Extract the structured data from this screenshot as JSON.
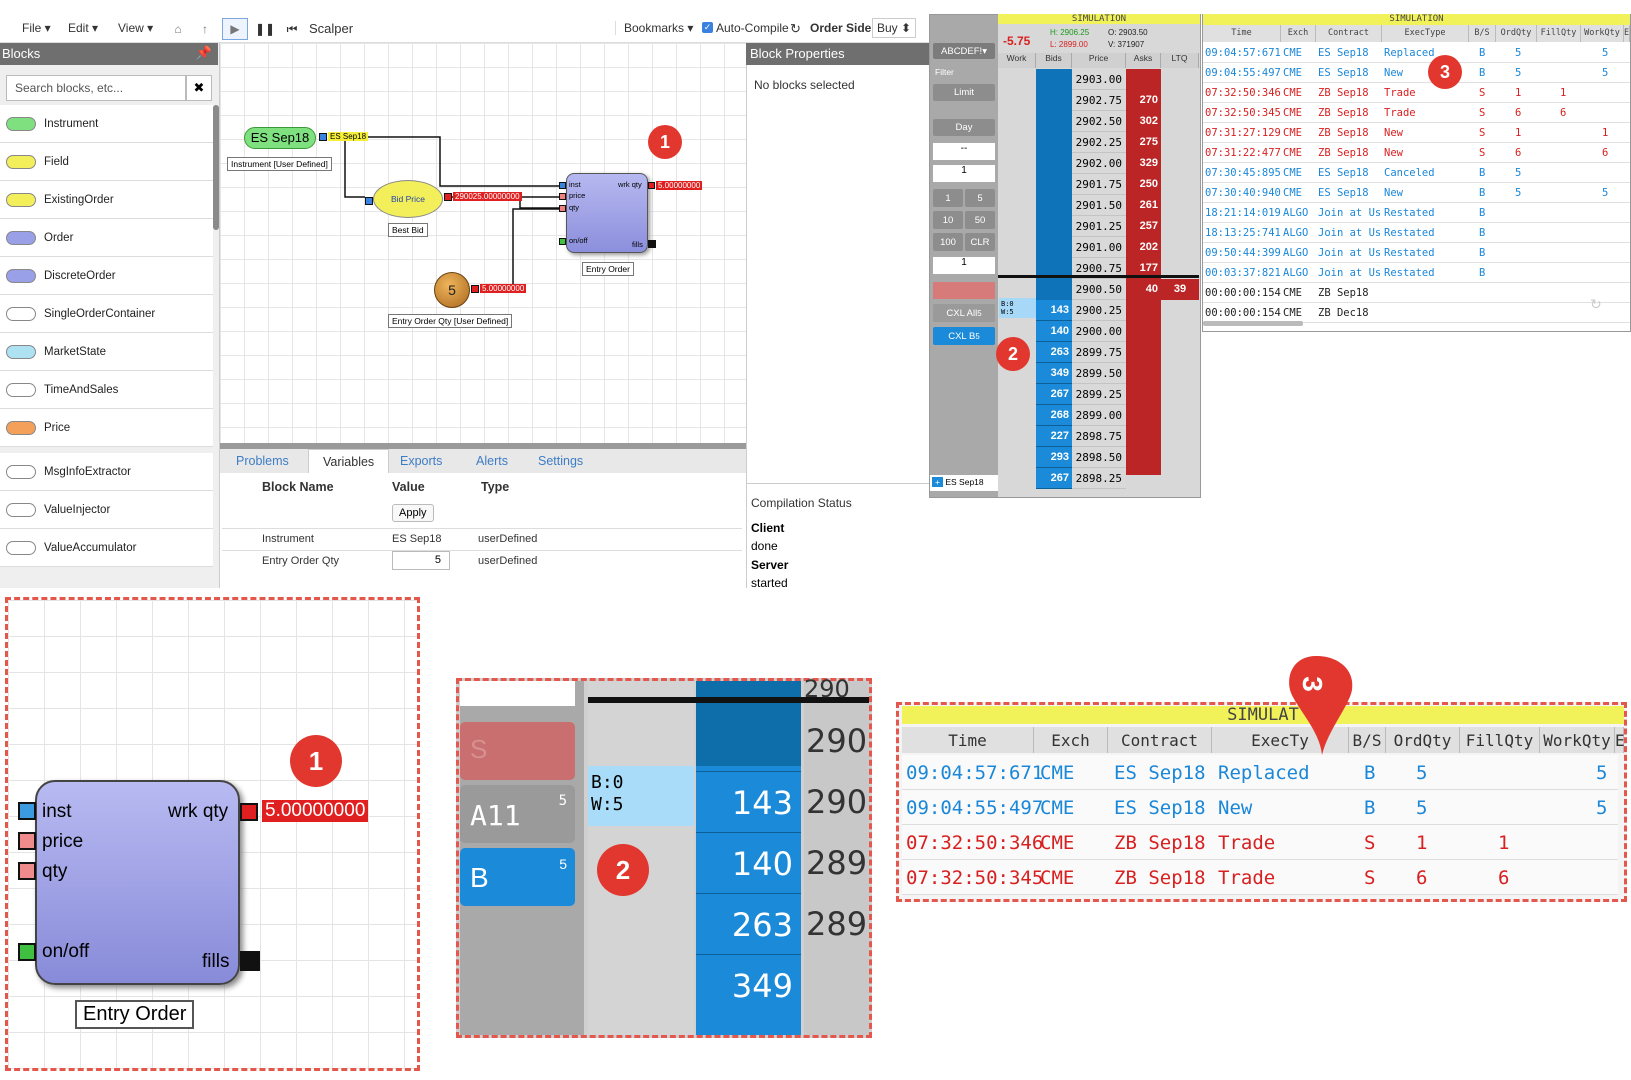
{
  "menu": {
    "file": "File ▾",
    "edit": "Edit ▾",
    "view": "View ▾",
    "app_title": "Scalper",
    "bookmarks": "Bookmarks ▾",
    "auto_compile": "Auto-Compile",
    "order_side_label": "Order Side",
    "order_side_value": "Buy ⬍"
  },
  "sidebar": {
    "header": "Blocks",
    "search_placeholder": "Search blocks, etc...",
    "items": [
      {
        "label": "Instrument",
        "color": "#7ee07e"
      },
      {
        "label": "Field",
        "color": "#f3ef5a"
      },
      {
        "label": "ExistingOrder",
        "color": "#f3ef5a"
      },
      {
        "label": "Order",
        "color": "#9aa0e8"
      },
      {
        "label": "DiscreteOrder",
        "color": "#9aa0e8"
      },
      {
        "label": "SingleOrderContainer",
        "color": "#ffffff"
      },
      {
        "label": "MarketState",
        "color": "#aee2f2"
      },
      {
        "label": "TimeAndSales",
        "color": "#ffffff"
      },
      {
        "label": "Price",
        "color": "#f5a05a"
      },
      {
        "label": "MsgInfoExtractor",
        "color": "#ffffff"
      },
      {
        "label": "ValueInjector",
        "color": "#ffffff"
      },
      {
        "label": "ValueAccumulator",
        "color": "#ffffff"
      }
    ]
  },
  "canvas": {
    "instrument_block": "ES Sep18",
    "instrument_out": "ES Sep18",
    "instrument_label": "Instrument [User Defined]",
    "bid_block": "Bid Price",
    "bid_label": "Best Bid",
    "bid_value": "290025.00000000",
    "qty_block": "5",
    "qty_value": "5.00000000",
    "qty_label": "Entry Order Qty [User Defined]",
    "order_label": "Entry Order",
    "order_ports": {
      "inst": "inst",
      "price": "price",
      "qty": "qty",
      "onoff": "on/off",
      "wrk": "wrk qty",
      "fills": "fills"
    },
    "order_value": "5.00000000",
    "callout": "1"
  },
  "bottom": {
    "tabs": [
      "Problems",
      "Variables",
      "Exports",
      "Alerts",
      "Settings"
    ],
    "headers": {
      "name": "Block Name",
      "value": "Value",
      "type": "Type"
    },
    "apply": "Apply",
    "rows": [
      {
        "name": "Instrument",
        "value": "ES Sep18",
        "type": "userDefined"
      },
      {
        "name": "Entry Order Qty",
        "value": "5",
        "type": "userDefined"
      }
    ]
  },
  "props": {
    "header": "Block Properties",
    "empty": "No blocks selected",
    "status_title": "Compilation Status",
    "client_label": "Client",
    "client_value": "done",
    "server_label": "Server",
    "server_value": "started"
  },
  "dom": {
    "sim": "SIMULATION",
    "change": "-5.75",
    "high": "H: 2906.25",
    "low": "L: 2899.00",
    "open": "O: 2903.50",
    "volume": "V: 371907",
    "account": "ABCDEF!▾",
    "filter": "Filter",
    "order_type": "Limit",
    "tif": "Day",
    "dash": "--",
    "qty": "1",
    "qty2": "1",
    "quick": [
      "1",
      "5",
      "10",
      "50",
      "100",
      "CLR"
    ],
    "cxl_all": "CXL All",
    "cxl_all_n": "5",
    "cxl_b": "CXL B",
    "cxl_b_n": "5",
    "footer_instr": "ES Sep18",
    "cols": [
      "Work",
      "Bids",
      "Price",
      "Asks",
      "LTQ"
    ],
    "work_label": "B:0\nW:5",
    "callout": "2",
    "ladder": [
      {
        "price": "2903.00",
        "bid": "",
        "ask": ""
      },
      {
        "price": "2902.75",
        "bid": "",
        "ask": "270"
      },
      {
        "price": "2902.50",
        "bid": "",
        "ask": "302"
      },
      {
        "price": "2902.25",
        "bid": "",
        "ask": "275"
      },
      {
        "price": "2902.00",
        "bid": "",
        "ask": "329"
      },
      {
        "price": "2901.75",
        "bid": "",
        "ask": "250"
      },
      {
        "price": "2901.50",
        "bid": "",
        "ask": "261"
      },
      {
        "price": "2901.25",
        "bid": "",
        "ask": "257"
      },
      {
        "price": "2901.00",
        "bid": "",
        "ask": "202"
      },
      {
        "price": "2900.75",
        "bid": "",
        "ask": "177"
      },
      {
        "price": "2900.50",
        "bid": "",
        "ask": "40",
        "ltq": "39"
      },
      {
        "price": "2900.25",
        "bid": "143",
        "ask": ""
      },
      {
        "price": "2900.00",
        "bid": "140",
        "ask": ""
      },
      {
        "price": "2899.75",
        "bid": "263",
        "ask": ""
      },
      {
        "price": "2899.50",
        "bid": "349",
        "ask": ""
      },
      {
        "price": "2899.25",
        "bid": "267",
        "ask": ""
      },
      {
        "price": "2899.00",
        "bid": "268",
        "ask": ""
      },
      {
        "price": "2898.75",
        "bid": "227",
        "ask": ""
      },
      {
        "price": "2898.50",
        "bid": "293",
        "ask": ""
      },
      {
        "price": "2898.25",
        "bid": "267",
        "ask": ""
      }
    ]
  },
  "orderbook": {
    "sim": "SIMULATION",
    "cols": [
      "Time",
      "Exch",
      "Contract",
      "ExecType",
      "B/S",
      "OrdQty",
      "FillQty",
      "WorkQty",
      "E"
    ],
    "callout": "3",
    "rows": [
      {
        "time": "09:04:57:671",
        "exch": "CME",
        "contract": "ES Sep18",
        "exec": "Replaced",
        "bs": "B",
        "ord": "5",
        "fill": "",
        "work": "5",
        "color": "#1a87d8"
      },
      {
        "time": "09:04:55:497",
        "exch": "CME",
        "contract": "ES Sep18",
        "exec": "New",
        "bs": "B",
        "ord": "5",
        "fill": "",
        "work": "5",
        "color": "#1a87d8"
      },
      {
        "time": "07:32:50:346",
        "exch": "CME",
        "contract": "ZB Sep18",
        "exec": "Trade",
        "bs": "S",
        "ord": "1",
        "fill": "1",
        "work": "",
        "color": "#d82020"
      },
      {
        "time": "07:32:50:345",
        "exch": "CME",
        "contract": "ZB Sep18",
        "exec": "Trade",
        "bs": "S",
        "ord": "6",
        "fill": "6",
        "work": "",
        "color": "#d82020"
      },
      {
        "time": "07:31:27:129",
        "exch": "CME",
        "contract": "ZB Sep18",
        "exec": "New",
        "bs": "S",
        "ord": "1",
        "fill": "",
        "work": "1",
        "color": "#d82020"
      },
      {
        "time": "07:31:22:477",
        "exch": "CME",
        "contract": "ZB Sep18",
        "exec": "New",
        "bs": "S",
        "ord": "6",
        "fill": "",
        "work": "6",
        "color": "#d82020"
      },
      {
        "time": "07:30:45:895",
        "exch": "CME",
        "contract": "ES Sep18",
        "exec": "Canceled",
        "bs": "B",
        "ord": "5",
        "fill": "",
        "work": "",
        "color": "#1a87d8"
      },
      {
        "time": "07:30:40:940",
        "exch": "CME",
        "contract": "ES Sep18",
        "exec": "New",
        "bs": "B",
        "ord": "5",
        "fill": "",
        "work": "5",
        "color": "#1a87d8"
      },
      {
        "time": "18:21:14:019",
        "exch": "ALGO",
        "contract": "Join at Us",
        "exec": "Restated",
        "bs": "B",
        "ord": "",
        "fill": "",
        "work": "",
        "color": "#1a87d8"
      },
      {
        "time": "18:13:25:741",
        "exch": "ALGO",
        "contract": "Join at Us",
        "exec": "Restated",
        "bs": "B",
        "ord": "",
        "fill": "",
        "work": "",
        "color": "#1a87d8"
      },
      {
        "time": "09:50:44:399",
        "exch": "ALGO",
        "contract": "Join at Us",
        "exec": "Restated",
        "bs": "B",
        "ord": "",
        "fill": "",
        "work": "",
        "color": "#1a87d8"
      },
      {
        "time": "00:03:37:821",
        "exch": "ALGO",
        "contract": "Join at Us",
        "exec": "Restated",
        "bs": "B",
        "ord": "",
        "fill": "",
        "work": "",
        "color": "#1a87d8"
      },
      {
        "time": "00:00:00:154",
        "exch": "CME",
        "contract": "ZB Sep18",
        "exec": "",
        "bs": "",
        "ord": "",
        "fill": "",
        "work": "",
        "color": "#222222"
      },
      {
        "time": "00:00:00:154",
        "exch": "CME",
        "contract": "ZB Dec18",
        "exec": "",
        "bs": "",
        "ord": "",
        "fill": "",
        "work": "",
        "color": "#222222"
      }
    ]
  },
  "zoom1": {
    "ports": {
      "inst": "inst",
      "price": "price",
      "qty": "qty",
      "onoff": "on/off",
      "wrk": "wrk qty",
      "fills": "fills"
    },
    "value": "5.00000000",
    "label": "Entry Order",
    "callout": "1"
  },
  "zoom2": {
    "all": "A11",
    "all_n": "5",
    "b": "B",
    "b_n": "5",
    "s": "S",
    "work": "B:0\nW:5",
    "bids": [
      "143",
      "140",
      "263",
      "349"
    ],
    "prices": [
      "290",
      "290",
      "289",
      "289"
    ],
    "top_price": "290",
    "callout": "2"
  },
  "zoom3": {
    "sim": "SIMULAT",
    "callout": "3",
    "cols": [
      "Time",
      "Exch",
      "Contract",
      "ExecTy",
      "B/S",
      "OrdQty",
      "FillQty",
      "WorkQty",
      "E"
    ],
    "rows": [
      {
        "time": "09:04:57:671",
        "exch": "CME",
        "contract": "ES Sep18",
        "exec": "Replaced",
        "bs": "B",
        "ord": "5",
        "fill": "",
        "work": "5",
        "color": "#1a87d8"
      },
      {
        "time": "09:04:55:497",
        "exch": "CME",
        "contract": "ES Sep18",
        "exec": "New",
        "bs": "B",
        "ord": "5",
        "fill": "",
        "work": "5",
        "color": "#1a87d8"
      },
      {
        "time": "07:32:50:346",
        "exch": "CME",
        "contract": "ZB Sep18",
        "exec": "Trade",
        "bs": "S",
        "ord": "1",
        "fill": "1",
        "work": "",
        "color": "#d82020"
      },
      {
        "time": "07:32:50:345",
        "exch": "CME",
        "contract": "ZB Sep18",
        "exec": "Trade",
        "bs": "S",
        "ord": "6",
        "fill": "6",
        "work": "",
        "color": "#d82020"
      }
    ]
  }
}
